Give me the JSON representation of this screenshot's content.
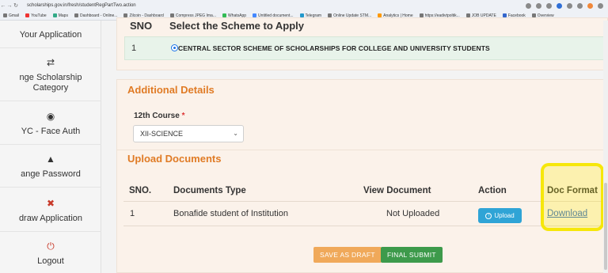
{
  "browser": {
    "url": "scholarships.gov.in/fresh/studentRegPartTwo.action",
    "bookmarks": [
      "Gmail",
      "YouTube",
      "Maps",
      "Dashboard - Online...",
      "Zilcoin - Dashboard",
      "Compress JPEG Ima...",
      "WhatsApp",
      "Untitled document...",
      "Telegram",
      "Online Update STM...",
      "Analytics | Home",
      "https://eadivtpoltik...",
      "JOB UPDATE",
      "Facebook",
      "Overview"
    ]
  },
  "sidebar": {
    "items": [
      {
        "label": "Your Application",
        "icon": "document-icon"
      },
      {
        "label": "nge Scholarship",
        "label2": "Category",
        "icon": "swap-arrows-icon"
      },
      {
        "label": "YC - Face Auth",
        "icon": "face-auth-icon"
      },
      {
        "label": "ange Password",
        "icon": "lock-icon"
      },
      {
        "label": "draw Application",
        "icon": "withdraw-icon"
      },
      {
        "label": "Logout",
        "icon": "power-icon"
      }
    ]
  },
  "scheme": {
    "sno_header": "SNO",
    "title_header": "Select the Scheme to Apply",
    "row_num": "1",
    "row_text": "CENTRAL SECTOR SCHEME OF SCHOLARSHIPS FOR COLLEGE AND UNIVERSITY STUDENTS"
  },
  "additional": {
    "title": "Additional Details",
    "course_label": "12th Course",
    "required_mark": "*",
    "course_value": "XII-SCIENCE"
  },
  "upload": {
    "title": "Upload Documents",
    "headers": [
      "SNO.",
      "Documents Type",
      "View Document",
      "Action",
      "Doc Format"
    ],
    "row": {
      "sno": "1",
      "type": "Bonafide student of Institution",
      "view": "Not Uploaded",
      "action": "Upload",
      "format": "Download"
    }
  },
  "actions": {
    "save_draft": "SAVE AS DRAFT",
    "final_submit": "FINAL SUBMIT"
  }
}
